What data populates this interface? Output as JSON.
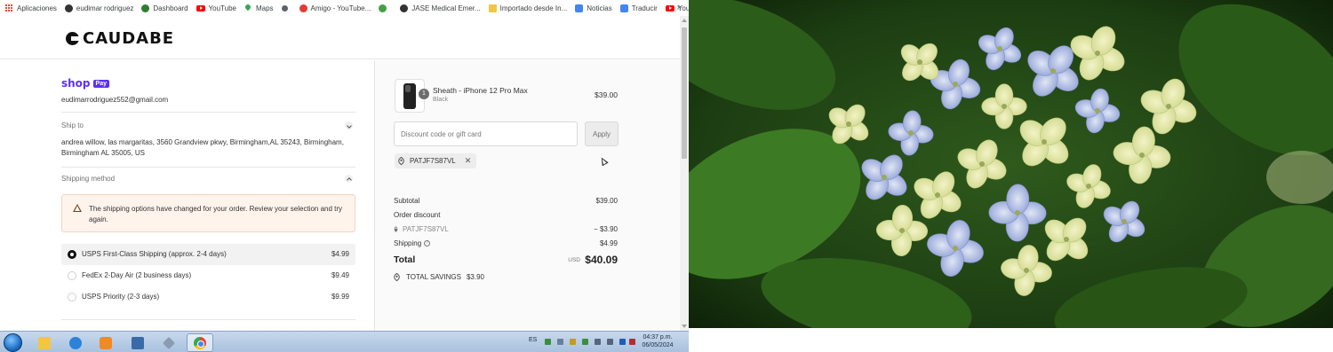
{
  "bookmarks": {
    "items": [
      {
        "label": "Aplicaciones",
        "icon": "apps-grid-icon"
      },
      {
        "label": "eudimar rodriguez",
        "icon": "github-icon"
      },
      {
        "label": "Dashboard",
        "icon": "dashboard-icon"
      },
      {
        "label": "YouTube",
        "icon": "youtube-icon"
      },
      {
        "label": "Maps",
        "icon": "maps-pin-icon"
      },
      {
        "label": "Amigo - YouTube...",
        "icon": "amigo-icon"
      },
      {
        "label": "JASE Medical Emer...",
        "icon": "github-icon"
      },
      {
        "label": "Importado desde In...",
        "icon": "folder-icon"
      },
      {
        "label": "Noticias",
        "icon": "news-icon"
      },
      {
        "label": "Traducir",
        "icon": "translate-icon"
      },
      {
        "label": "YouTube",
        "icon": "youtube-icon"
      }
    ],
    "more": "»"
  },
  "store": {
    "brand": "CAUDABE"
  },
  "contact": {
    "shop_label": "shop",
    "pay_label": "Pay",
    "email": "eudimarrodriguez552@gmail.com"
  },
  "ship_to": {
    "label": "Ship to",
    "address": "andrea willow, las margaritas, 3560 Grandview pkwy, Birmingham,AL 35243, Birmingham, Birmingham AL 35005, US"
  },
  "shipping_method": {
    "label": "Shipping method",
    "alert": "The shipping options have changed for your order. Review your selection and try again.",
    "options": [
      {
        "label": "USPS First-Class Shipping (approx. 2-4 days)",
        "price": "$4.99",
        "selected": true
      },
      {
        "label": "FedEx 2-Day Air (2 business days)",
        "price": "$9.49",
        "selected": false
      },
      {
        "label": "USPS Priority (2-3 days)",
        "price": "$9.99",
        "selected": false
      }
    ]
  },
  "order": {
    "product": {
      "name": "Sheath - iPhone 12 Pro Max",
      "variant": "Black",
      "price": "$39.00",
      "quantity": "1"
    },
    "discount_placeholder": "Discount code or gift card",
    "apply_label": "Apply",
    "applied_code": "PATJF7S87VL",
    "remove_symbol": "✕",
    "summary": {
      "subtotal_label": "Subtotal",
      "subtotal": "$39.00",
      "order_discount_label": "Order discount",
      "discount_code": "PATJF7S87VL",
      "discount_value": "− $3.90",
      "shipping_label": "Shipping",
      "shipping_info": "?",
      "shipping": "$4.99",
      "total_label": "Total",
      "currency": "USD",
      "total": "$40.09",
      "savings_label": "TOTAL SAVINGS",
      "savings": "$3.90"
    }
  },
  "taskbar": {
    "language": "ES",
    "time": "04:37 p.m.",
    "date": "06/05/2024"
  },
  "colors": {
    "shop_pay": "#5a31f4",
    "alert_bg": "#fff4ec",
    "taskbar": "#b9cde6"
  }
}
